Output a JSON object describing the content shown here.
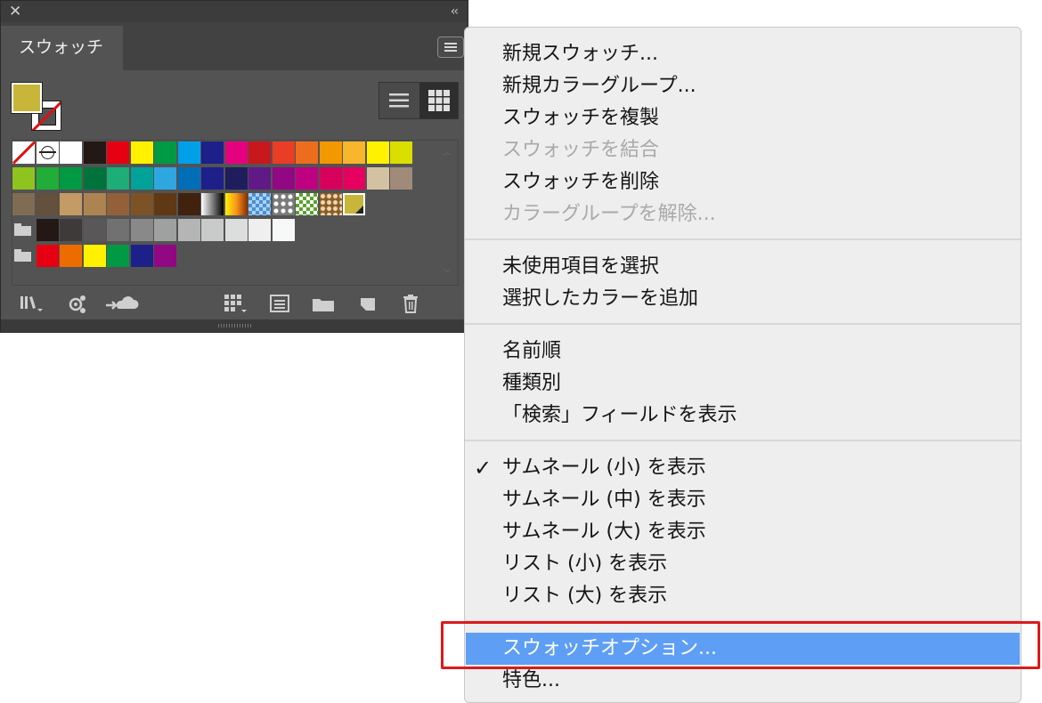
{
  "panel": {
    "close_glyph": "✕",
    "collapse_glyph": "‹‹",
    "tab_label": "スウォッチ",
    "fill_color": "#c7b63a",
    "view_mode": "grid",
    "swatch_rows": [
      [
        "none",
        "registration",
        "#ffffff",
        "#231815",
        "#e60012",
        "#fff100",
        "#009944",
        "#00a0e9",
        "#1d2088",
        "#e4007f",
        "#c9171e",
        "#ea3d25",
        "#ed6d1e",
        "#f39800",
        "#f8b62d",
        "#fff100",
        "#dadf00"
      ],
      [
        "#8fc31f",
        "#22ac38",
        "#009944",
        "#00733c",
        "#1cae76",
        "#00a29a",
        "#2ea7e0",
        "#036eb8",
        "#1d2088",
        "#1f1d5b",
        "#601986",
        "#920783",
        "#be0081",
        "#d7005d",
        "#e60060",
        "#d3c2a2",
        "#a08b7a"
      ],
      [
        "#7f6c52",
        "#63503d",
        "#c49a65",
        "#ad8451",
        "#946039",
        "#7c5226",
        "#603813",
        "#40220f",
        "gradient-bw",
        "gradient-orange",
        "pattern-blue",
        "pattern-dots",
        "pattern-green",
        "pattern-brown",
        "#c7b63a"
      ],
      [
        "folder",
        "#231815",
        "#3e3a39",
        "#595757",
        "#727171",
        "#898989",
        "#9fa0a0",
        "#b5b5b6",
        "#c9caca",
        "#dcdddd",
        "#efefef",
        "#f7f8f8"
      ],
      [
        "folder",
        "#e60012",
        "#ed6c00",
        "#fff100",
        "#009944",
        "#1d2088",
        "#920783"
      ]
    ]
  },
  "menu": {
    "sections": [
      [
        {
          "label": "新規スウォッチ...",
          "disabled": false
        },
        {
          "label": "新規カラーグループ...",
          "disabled": false
        },
        {
          "label": "スウォッチを複製",
          "disabled": false
        },
        {
          "label": "スウォッチを結合",
          "disabled": true
        },
        {
          "label": "スウォッチを削除",
          "disabled": false
        },
        {
          "label": "カラーグループを解除...",
          "disabled": true
        }
      ],
      [
        {
          "label": "未使用項目を選択",
          "disabled": false
        },
        {
          "label": "選択したカラーを追加",
          "disabled": false
        }
      ],
      [
        {
          "label": "名前順",
          "disabled": false
        },
        {
          "label": "種類別",
          "disabled": false
        },
        {
          "label": "「検索」フィールドを表示",
          "disabled": false
        }
      ],
      [
        {
          "label": "サムネール (小) を表示",
          "checked": true
        },
        {
          "label": "サムネール (中) を表示"
        },
        {
          "label": "サムネール (大) を表示"
        },
        {
          "label": "リスト (小) を表示"
        },
        {
          "label": "リスト (大) を表示"
        }
      ],
      [
        {
          "label": "スウォッチオプション...",
          "highlighted": true
        },
        {
          "label": "特色..."
        }
      ]
    ],
    "check_glyph": "✓",
    "highlight_color": "#5e9ef5",
    "callout_color": "#dc1a1a"
  }
}
